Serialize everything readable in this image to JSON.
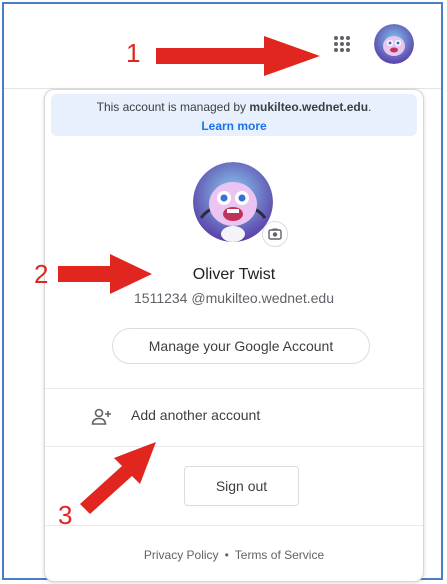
{
  "callouts": [
    "1",
    "2",
    "3"
  ],
  "managed_banner": {
    "prefix": "This account is managed by ",
    "domain": "mukilteo.wednet.edu",
    "suffix": ".",
    "learn_more": "Learn more"
  },
  "account": {
    "name": "Oliver Twist",
    "email": "1511234 @mukilteo.wednet.edu"
  },
  "buttons": {
    "manage": "Manage your Google Account",
    "add_account": "Add another account",
    "sign_out": "Sign out"
  },
  "footer": {
    "privacy": "Privacy Policy",
    "separator": "•",
    "terms": "Terms of Service"
  },
  "colors": {
    "callout": "#e0261f",
    "link": "#1a73e8",
    "banner_bg": "#e8f0fe",
    "frame_border": "#4a7fc1"
  },
  "icons": [
    "apps-grid-icon",
    "avatar-icon",
    "camera-icon",
    "add-person-icon"
  ]
}
